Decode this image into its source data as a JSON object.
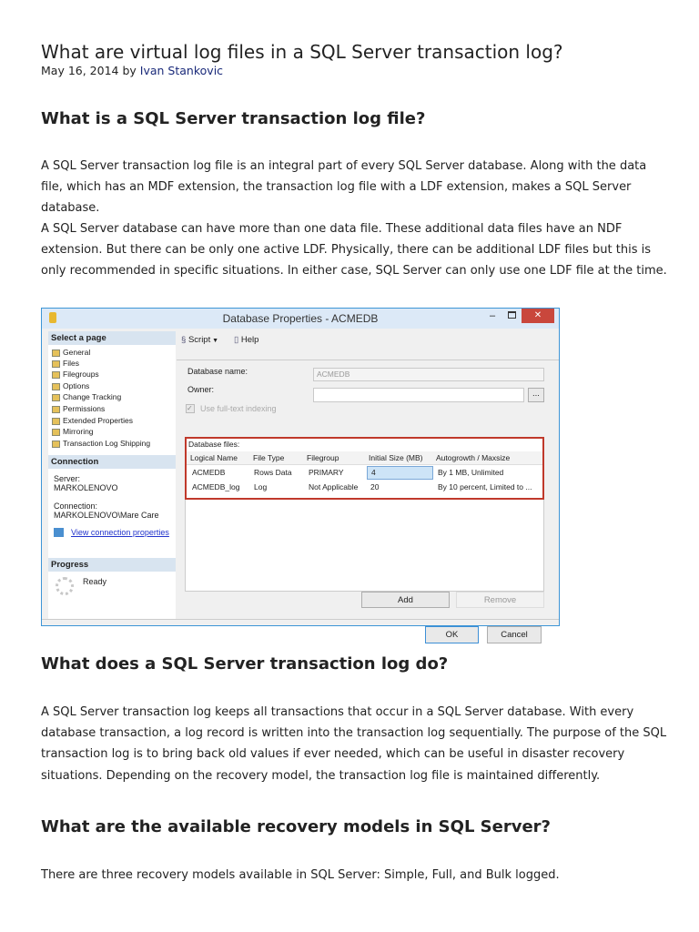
{
  "article": {
    "title": "What are virtual log files in a SQL Server transaction log?",
    "date": "May 16, 2014",
    "by": "by",
    "author": "Ivan Stankovic",
    "h1": "What is a SQL Server transaction log file?",
    "p1": "A SQL Server transaction log file is an integral part of every SQL Server database. Along with the data file, which has an MDF extension, the transaction log file with a LDF extension, makes a SQL Server database.",
    "p2": "A SQL Server database can have more than one data file. These additional data files have an NDF extension. But there can be only one active LDF. Physically, there can be additional LDF files but this is only recommended in specific situations. In either case, SQL Server can only use one LDF file at the time.",
    "h2": "What does a SQL Server transaction log do?",
    "p3": "A SQL Server transaction log keeps all transactions that occur in a SQL Server database. With every database transaction, a log record is written into the transaction log sequentially. The purpose of the SQL transaction log is to bring back old values if ever needed, which can be useful in disaster recovery situations. Depending on the recovery model, the transaction log file is maintained differently.",
    "h3": "What are the available recovery models in SQL Server?",
    "p4": "There are three recovery models available in SQL Server: Simple, Full, and Bulk logged."
  },
  "dialog": {
    "title": "Database Properties - ACMEDB",
    "select_page": "Select a page",
    "pages": [
      "General",
      "Files",
      "Filegroups",
      "Options",
      "Change Tracking",
      "Permissions",
      "Extended Properties",
      "Mirroring",
      "Transaction Log Shipping"
    ],
    "connection": "Connection",
    "server_label": "Server:",
    "server": "MARKOLENOVO",
    "connection_label": "Connection:",
    "connection_value": "MARKOLENOVO\\Mare Care",
    "view_conn": "View connection properties",
    "progress": "Progress",
    "ready": "Ready",
    "script": "Script",
    "help": "Help",
    "dbname_label": "Database name:",
    "dbname": "ACMEDB",
    "owner_label": "Owner:",
    "owner_btn": "...",
    "fulltext": "Use full-text indexing",
    "files_label": "Database files:",
    "columns": [
      "Logical Name",
      "File Type",
      "Filegroup",
      "Initial Size (MB)",
      "Autogrowth / Maxsize"
    ],
    "rows": [
      [
        "ACMEDB",
        "Rows Data",
        "PRIMARY",
        "4",
        "By 1 MB, Unlimited"
      ],
      [
        "ACMEDB_log",
        "Log",
        "Not Applicable",
        "20",
        "By 10 percent, Limited to ..."
      ]
    ],
    "add": "Add",
    "remove": "Remove",
    "ok": "OK",
    "cancel": "Cancel",
    "colors": {
      "accent_border": "#3d95d6",
      "highlight": "#c0392b",
      "close": "#c9473c"
    }
  }
}
